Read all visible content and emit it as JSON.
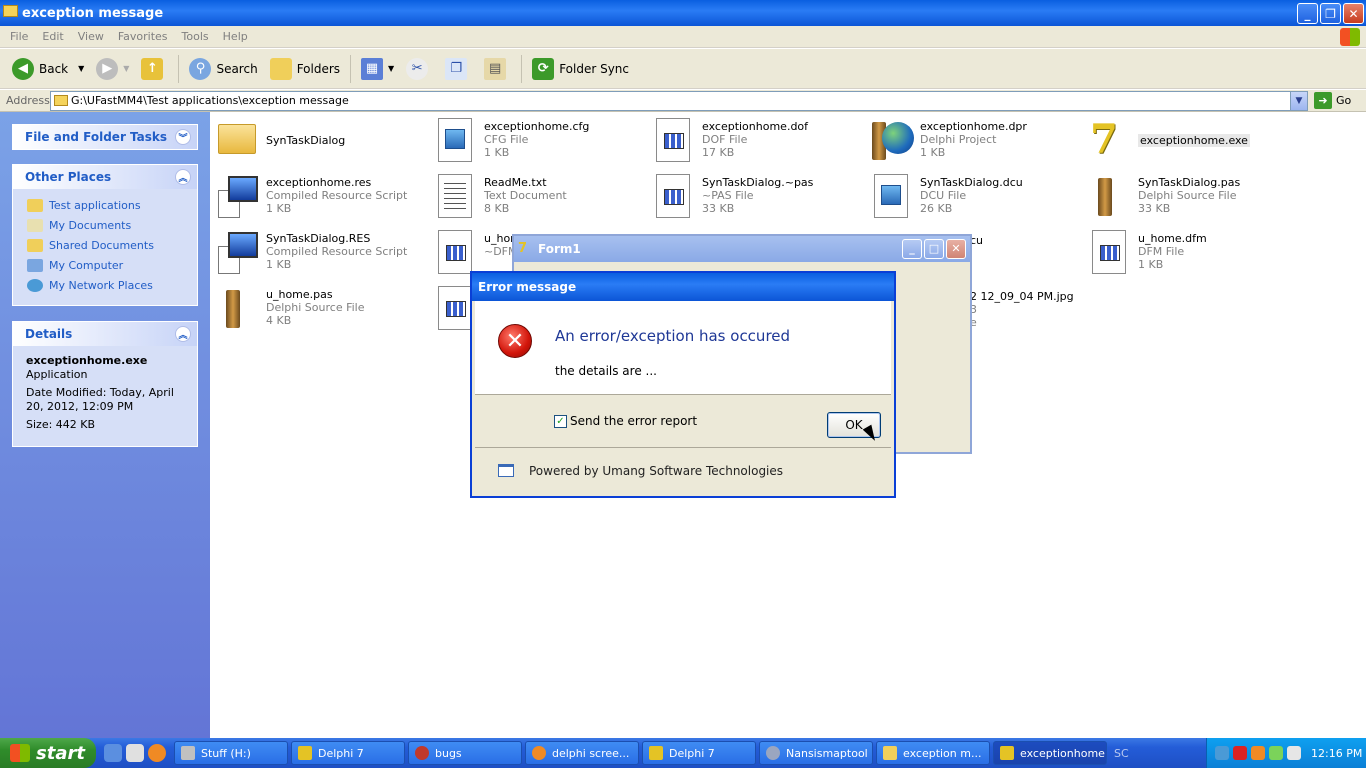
{
  "window": {
    "title": "exception message"
  },
  "menu": [
    "File",
    "Edit",
    "View",
    "Favorites",
    "Tools",
    "Help"
  ],
  "toolbar": {
    "back": "Back",
    "search": "Search",
    "folders": "Folders",
    "folder_sync": "Folder Sync"
  },
  "address": {
    "label": "Address",
    "path": "G:\\UFastMM4\\Test applications\\exception message",
    "go": "Go"
  },
  "tasks": {
    "file_folder": "File and Folder Tasks",
    "other_places": "Other Places",
    "places": [
      "Test applications",
      "My Documents",
      "Shared Documents",
      "My Computer",
      "My Network Places"
    ],
    "details_title": "Details",
    "details": {
      "name": "exceptionhome.exe",
      "type": "Application",
      "modified": "Date Modified: Today, April 20, 2012, 12:09 PM",
      "size": "Size: 442 KB"
    }
  },
  "files": [
    {
      "name": "SynTaskDialog",
      "type": "",
      "size": "",
      "icon": "folder"
    },
    {
      "name": "exceptionhome.cfg",
      "type": "CFG File",
      "size": "1 KB",
      "icon": "cfg"
    },
    {
      "name": "exceptionhome.dof",
      "type": "DOF File",
      "size": "17 KB",
      "icon": "grid"
    },
    {
      "name": "exceptionhome.dpr",
      "type": "Delphi Project",
      "size": "1 KB",
      "icon": "globe"
    },
    {
      "name": "exceptionhome.exe",
      "type": "",
      "size": "",
      "icon": "delphi"
    },
    {
      "name": "exceptionhome.res",
      "type": "Compiled Resource Script",
      "size": "1 KB",
      "icon": "monitor"
    },
    {
      "name": "ReadMe.txt",
      "type": "Text Document",
      "size": "8 KB",
      "icon": "text"
    },
    {
      "name": "SynTaskDialog.~pas",
      "type": "~PAS File",
      "size": "33 KB",
      "icon": "grid"
    },
    {
      "name": "SynTaskDialog.dcu",
      "type": "DCU File",
      "size": "26 KB",
      "icon": "cfg"
    },
    {
      "name": "SynTaskDialog.pas",
      "type": "Delphi Source File",
      "size": "33 KB",
      "icon": "pillar"
    },
    {
      "name": "SynTaskDialog.RES",
      "type": "Compiled Resource Script",
      "size": "1 KB",
      "icon": "monitor"
    },
    {
      "name": "u_hom",
      "type": "~DFM",
      "size": "",
      "icon": "grid"
    },
    {
      "name": "u_home.dfm",
      "type": "DFM File",
      "size": "1 KB",
      "icon": "grid"
    },
    {
      "name": "u_home.pas",
      "type": "Delphi Source File",
      "size": "4 KB",
      "icon": "pillar"
    },
    {
      "name": "",
      "type": "",
      "size": "",
      "icon": "grid"
    }
  ],
  "partial": {
    "cu": "cu",
    "jpg": "2 12_09_04 PM.jpg",
    "l1": "3",
    "l2": "e"
  },
  "form1": {
    "title": "Form1"
  },
  "dialog": {
    "title": "Error message",
    "headline": "An error/exception has occured",
    "details": "the details are ...",
    "checkbox": "Send the error report",
    "ok": "OK",
    "powered": "Powered by Umang Software Technologies"
  },
  "taskbar": {
    "start": "start",
    "items": [
      "Stuff (H:)",
      "Delphi 7",
      "bugs",
      "delphi scree...",
      "Delphi 7",
      "Nansismaptool",
      "exception m...",
      "exceptionhome"
    ],
    "tray_text": "SC",
    "clock": "12:16 PM"
  },
  "colors": {
    "xp_blue": "#0a5fe0",
    "taskpane": "#6375d6",
    "link": "#215dc6",
    "error_red": "#d2150a"
  }
}
